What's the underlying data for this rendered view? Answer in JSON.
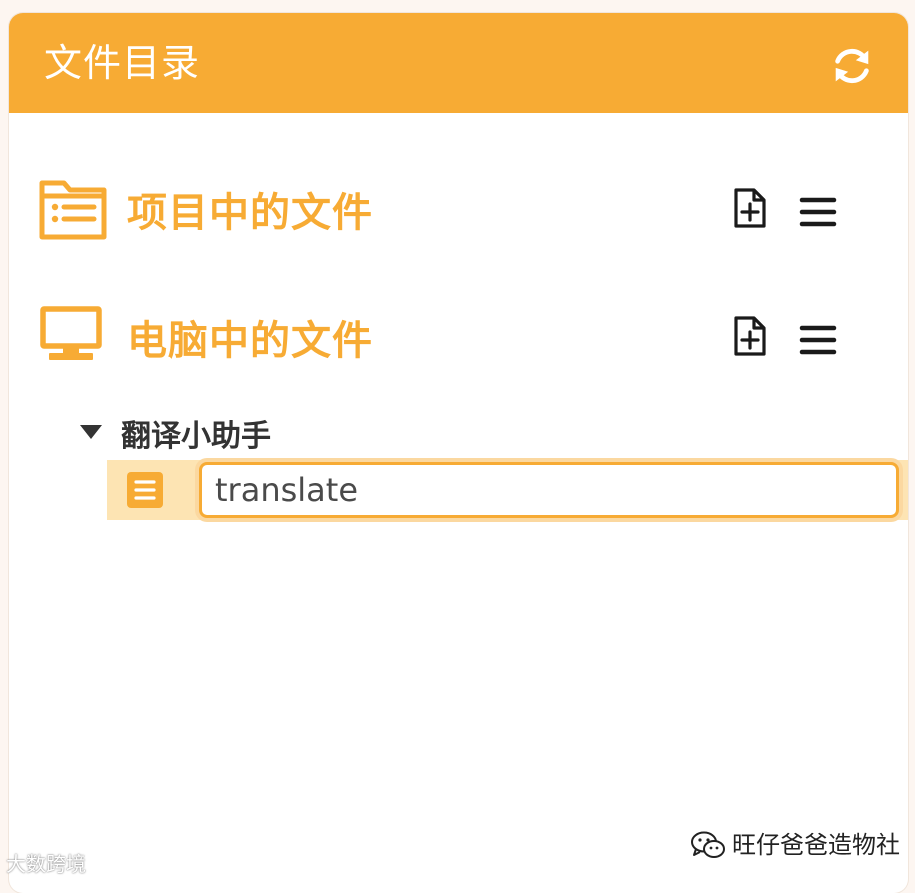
{
  "header": {
    "title": "文件目录",
    "refresh_icon": "refresh-icon"
  },
  "sections": [
    {
      "title": "项目中的文件",
      "icon": "folder-list-icon",
      "actions": [
        "add-file-icon",
        "menu-icon"
      ]
    },
    {
      "title": "电脑中的文件",
      "icon": "monitor-icon",
      "actions": [
        "add-file-icon",
        "menu-icon"
      ]
    }
  ],
  "tree": {
    "folder": {
      "label": "翻译小助手",
      "expanded": true
    },
    "new_file": {
      "icon": "document-icon",
      "input_value": "translate"
    }
  },
  "watermarks": {
    "left": "大数跨境",
    "right": "旺仔爸爸造物社"
  },
  "colors": {
    "accent": "#f7ab34",
    "selection": "#fde4b3",
    "icon_dark": "#1a1a1a",
    "text_dark": "#333333"
  }
}
